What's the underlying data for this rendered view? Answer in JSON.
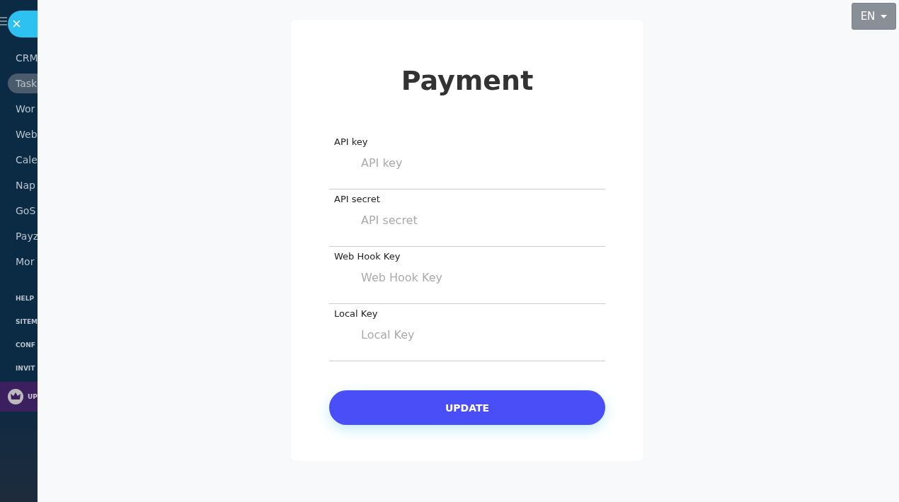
{
  "sidebar": {
    "close_button": "×",
    "items": [
      {
        "label": "CRM",
        "selected": false
      },
      {
        "label": "Task",
        "selected": true
      },
      {
        "label": "Wor",
        "selected": false
      },
      {
        "label": "Web",
        "selected": false
      },
      {
        "label": "Cale",
        "selected": false
      },
      {
        "label": "Nap",
        "selected": false
      },
      {
        "label": "GoS",
        "selected": false
      },
      {
        "label": "Payz",
        "selected": false
      },
      {
        "label": "Mor",
        "selected": false
      }
    ],
    "links": [
      "HELP",
      "SITEM",
      "CONF",
      "INVIT"
    ],
    "upgrade": "UP"
  },
  "language": {
    "label": "EN"
  },
  "form": {
    "title": "Payment",
    "fields": [
      {
        "label": "API key",
        "placeholder": "API key"
      },
      {
        "label": "API secret",
        "placeholder": "API secret"
      },
      {
        "label": "Web Hook Key",
        "placeholder": "Web Hook Key"
      },
      {
        "label": "Local Key",
        "placeholder": "Local Key"
      }
    ],
    "submit": "UPDATE"
  }
}
